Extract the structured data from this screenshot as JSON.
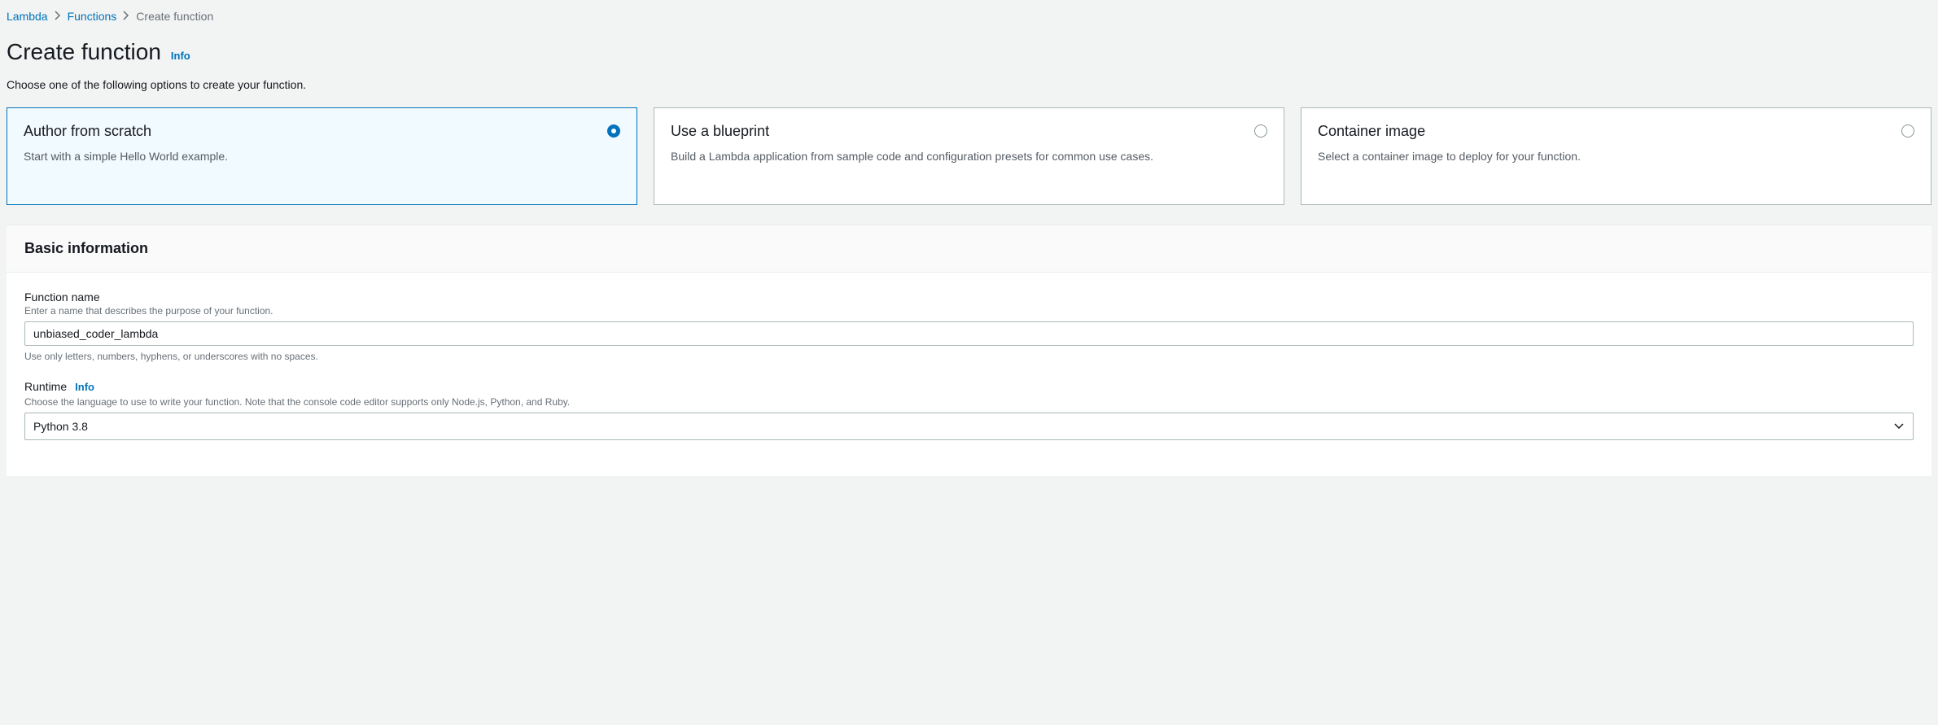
{
  "breadcrumb": {
    "items": [
      {
        "label": "Lambda",
        "link": true
      },
      {
        "label": "Functions",
        "link": true
      },
      {
        "label": "Create function",
        "link": false
      }
    ]
  },
  "header": {
    "title": "Create function",
    "info": "Info",
    "subtitle": "Choose one of the following options to create your function."
  },
  "options": [
    {
      "title": "Author from scratch",
      "desc": "Start with a simple Hello World example.",
      "selected": true
    },
    {
      "title": "Use a blueprint",
      "desc": "Build a Lambda application from sample code and configuration presets for common use cases.",
      "selected": false
    },
    {
      "title": "Container image",
      "desc": "Select a container image to deploy for your function.",
      "selected": false
    }
  ],
  "panel": {
    "title": "Basic information"
  },
  "form": {
    "functionName": {
      "label": "Function name",
      "hint": "Enter a name that describes the purpose of your function.",
      "value": "unbiased_coder_lambda",
      "help": "Use only letters, numbers, hyphens, or underscores with no spaces."
    },
    "runtime": {
      "label": "Runtime",
      "info": "Info",
      "hint": "Choose the language to use to write your function. Note that the console code editor supports only Node.js, Python, and Ruby.",
      "value": "Python 3.8"
    }
  }
}
